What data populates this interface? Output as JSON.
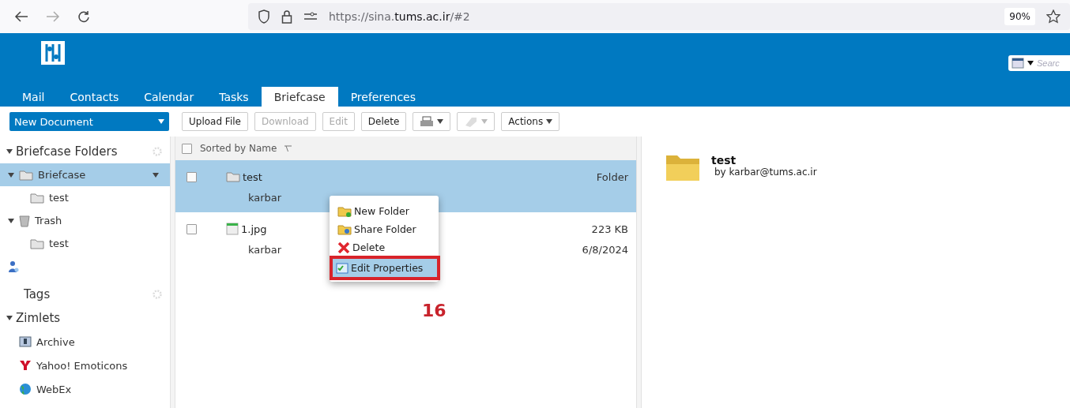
{
  "browser": {
    "url": "https://sina.**tums.ac.ir**/#2",
    "zoom": "90%"
  },
  "header": {
    "search": {
      "placeholder": "Searc"
    }
  },
  "tabs": [
    {
      "label": "Mail",
      "selected": false
    },
    {
      "label": "Contacts",
      "selected": false
    },
    {
      "label": "Calendar",
      "selected": false
    },
    {
      "label": "Tasks",
      "selected": false
    },
    {
      "label": "Briefcase",
      "selected": true
    },
    {
      "label": "Preferences",
      "selected": false
    }
  ],
  "toolbar": {
    "new_button": "New Document",
    "buttons": [
      {
        "kind": "text",
        "label": "Upload File",
        "disabled": false
      },
      {
        "kind": "text",
        "label": "Download",
        "disabled": true
      },
      {
        "kind": "text",
        "label": "Edit",
        "disabled": true
      },
      {
        "kind": "text",
        "label": "Delete",
        "disabled": false
      },
      {
        "kind": "print",
        "disabled": false
      },
      {
        "kind": "tag",
        "disabled": true
      },
      {
        "kind": "menu",
        "label": "Actions",
        "disabled": false
      }
    ]
  },
  "sidebar": {
    "folders_heading": "Briefcase Folders",
    "folders": [
      {
        "kind": "folder",
        "label": "Briefcase",
        "selected": true,
        "expanded": true,
        "children": [
          {
            "kind": "folder",
            "label": "test",
            "selected": false
          }
        ]
      },
      {
        "kind": "trash",
        "label": "Trash",
        "selected": false,
        "expanded": true,
        "children": [
          {
            "kind": "folder",
            "label": "test",
            "selected": false
          }
        ]
      },
      {
        "kind": "shared",
        "selected": false
      }
    ],
    "tags_heading": "Tags",
    "zimlets_heading": "Zimlets",
    "zimlets": [
      {
        "kind": "archive",
        "label": "Archive"
      },
      {
        "kind": "yahoo",
        "label": "Yahoo! Emoticons"
      },
      {
        "kind": "webex",
        "label": "WebEx"
      }
    ]
  },
  "list": {
    "header": "Sorted by Name",
    "all_checked": false,
    "rows": [
      {
        "kind": "folder",
        "name": "test",
        "owner": "karbar",
        "info": "Folder",
        "selected": true,
        "checked": false
      },
      {
        "kind": "image",
        "name": "1.jpg",
        "owner": "karbar",
        "info": "223 KB",
        "date": "6/8/2024",
        "selected": false,
        "checked": false
      }
    ]
  },
  "context_menu": [
    {
      "kind": "new",
      "label": "New Folder",
      "selected": false
    },
    {
      "kind": "share",
      "label": "Share Folder",
      "selected": false
    },
    {
      "kind": "delete",
      "label": "Delete",
      "selected": false
    },
    {
      "kind": "props",
      "label": "Edit Properties",
      "selected": true
    }
  ],
  "annotation": "16",
  "preview": {
    "title": "test",
    "byline": "by karbar@tums.ac.ir"
  }
}
